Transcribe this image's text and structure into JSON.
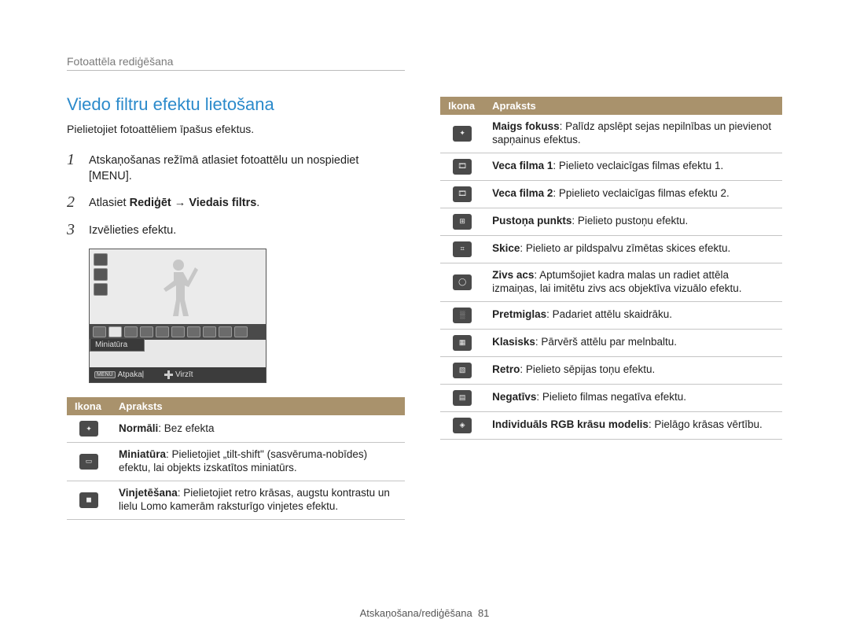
{
  "breadcrumb": "Fotoattēla rediģēšana",
  "title": "Viedo filtru efektu lietošana",
  "intro": "Pielietojiet fotoattēliem īpašus efektus.",
  "steps": {
    "s1": "Atskaņošanas režīmā atlasiet fotoattēlu un nospiediet [MENU].",
    "s2_pre": "Atlasiet ",
    "s2_bold": "Rediģēt → Viedais filtrs",
    "s2_post": ".",
    "s3": "Izvēlieties efektu."
  },
  "screenshot": {
    "label": "Miniatūra",
    "back": "Atpakaļ",
    "move": "Virzīt",
    "menu": "MENU"
  },
  "table_headers": {
    "icon": "Ikona",
    "desc": "Apraksts"
  },
  "left_rows": [
    {
      "icon": "off-icon",
      "glyph": "✦",
      "bold": "Normāli",
      "rest": ": Bez efekta"
    },
    {
      "icon": "miniature-icon",
      "glyph": "▭",
      "bold": "Miniatūra",
      "rest": ": Pielietojiet „tilt-shift\" (sasvēruma-nobīdes) efektu, lai objekts izskatītos miniatūrs."
    },
    {
      "icon": "vignette-icon",
      "glyph": "◼",
      "bold": "Vinjetēšana",
      "rest": ": Pielietojiet retro krāsas, augstu kontrastu un lielu Lomo kamerām raksturīgo vinjetes efektu."
    }
  ],
  "right_rows": [
    {
      "icon": "soft-focus-icon",
      "glyph": "✦",
      "bold": "Maigs fokuss",
      "rest": ": Palīdz apslēpt sejas nepilnības un pievienot sapņainus efektus."
    },
    {
      "icon": "old-film-1-icon",
      "glyph": "🎞",
      "bold": "Veca filma 1",
      "rest": ": Pielieto veclaicīgas filmas efektu 1."
    },
    {
      "icon": "old-film-2-icon",
      "glyph": "🎞",
      "bold": "Veca filma 2",
      "rest": ": Ppielieto veclaicīgas filmas efektu 2."
    },
    {
      "icon": "halftone-icon",
      "glyph": "⊞",
      "bold": "Pustoņa punkts",
      "rest": ": Pielieto pustoņu efektu."
    },
    {
      "icon": "sketch-icon",
      "glyph": "⌗",
      "bold": "Skice",
      "rest": ": Pielieto ar pildspalvu zīmētas skices efektu."
    },
    {
      "icon": "fisheye-icon",
      "glyph": "◯",
      "bold": "Zivs acs",
      "rest": ": Aptumšojiet kadra malas un radiet attēla izmaiņas, lai imitētu zivs acs objektīva vizuālo efektu."
    },
    {
      "icon": "defog-icon",
      "glyph": "░",
      "bold": "Pretmiglas",
      "rest": ": Padariet attēlu skaidrāku."
    },
    {
      "icon": "classic-icon",
      "glyph": "▦",
      "bold": "Klasisks",
      "rest": ": Pārvērš attēlu par melnbaltu."
    },
    {
      "icon": "retro-icon",
      "glyph": "▧",
      "bold": "Retro",
      "rest": ": Pielieto sēpijas toņu efektu."
    },
    {
      "icon": "negative-icon",
      "glyph": "▤",
      "bold": "Negatīvs",
      "rest": ": Pielieto filmas negatīva efektu."
    },
    {
      "icon": "custom-rgb-icon",
      "glyph": "◈",
      "bold": "Individuāls RGB krāsu modelis",
      "rest": ": Pielāgo krāsas vērtību."
    }
  ],
  "footer": {
    "text": "Atskaņošana/rediģēšana",
    "page": "81"
  }
}
